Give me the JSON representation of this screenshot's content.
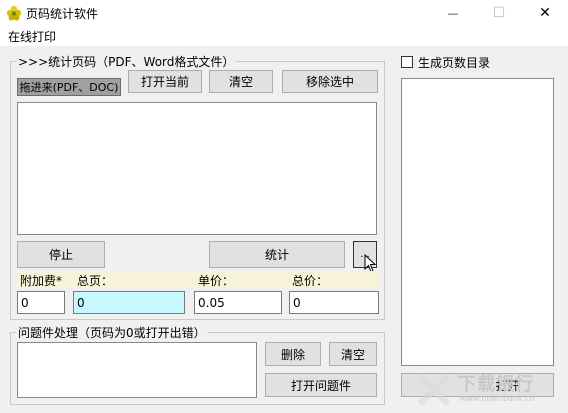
{
  "window": {
    "title": "页码统计软件",
    "minimize_glyph": "—",
    "maximize_glyph": "☐",
    "close_glyph": "✕"
  },
  "menu": {
    "online_print": "在线打印"
  },
  "stats_group": {
    "label": ">>>统计页码（PDF、Word格式文件）",
    "drag_label": "拖进来(PDF、DOC)",
    "open_current": "打开当前",
    "clear": "清空",
    "remove_selected": "移除选中",
    "stop": "停止",
    "count": "统计",
    "extra_button": "..."
  },
  "fields": {
    "surcharge_label": "附加费*",
    "total_pages_label": "总页：",
    "unit_price_label": "单价：",
    "total_price_label": "总价：",
    "surcharge_value": "0",
    "total_pages_value": "0",
    "unit_price_value": "0.05",
    "total_price_value": "0"
  },
  "problem_group": {
    "label": "问题件处理（页码为0或打开出错）",
    "delete": "删除",
    "clear": "清空",
    "open_problem": "打开问题件"
  },
  "toc": {
    "checkbox_label": "生成页数目录",
    "checked": false,
    "open_button": "打开"
  },
  "watermark": {
    "text": "下载银行",
    "url": "www.downbank.cn"
  },
  "colors": {
    "total_pages_bg": "#c8f8ff",
    "label_strip": "#f7f3d8"
  }
}
